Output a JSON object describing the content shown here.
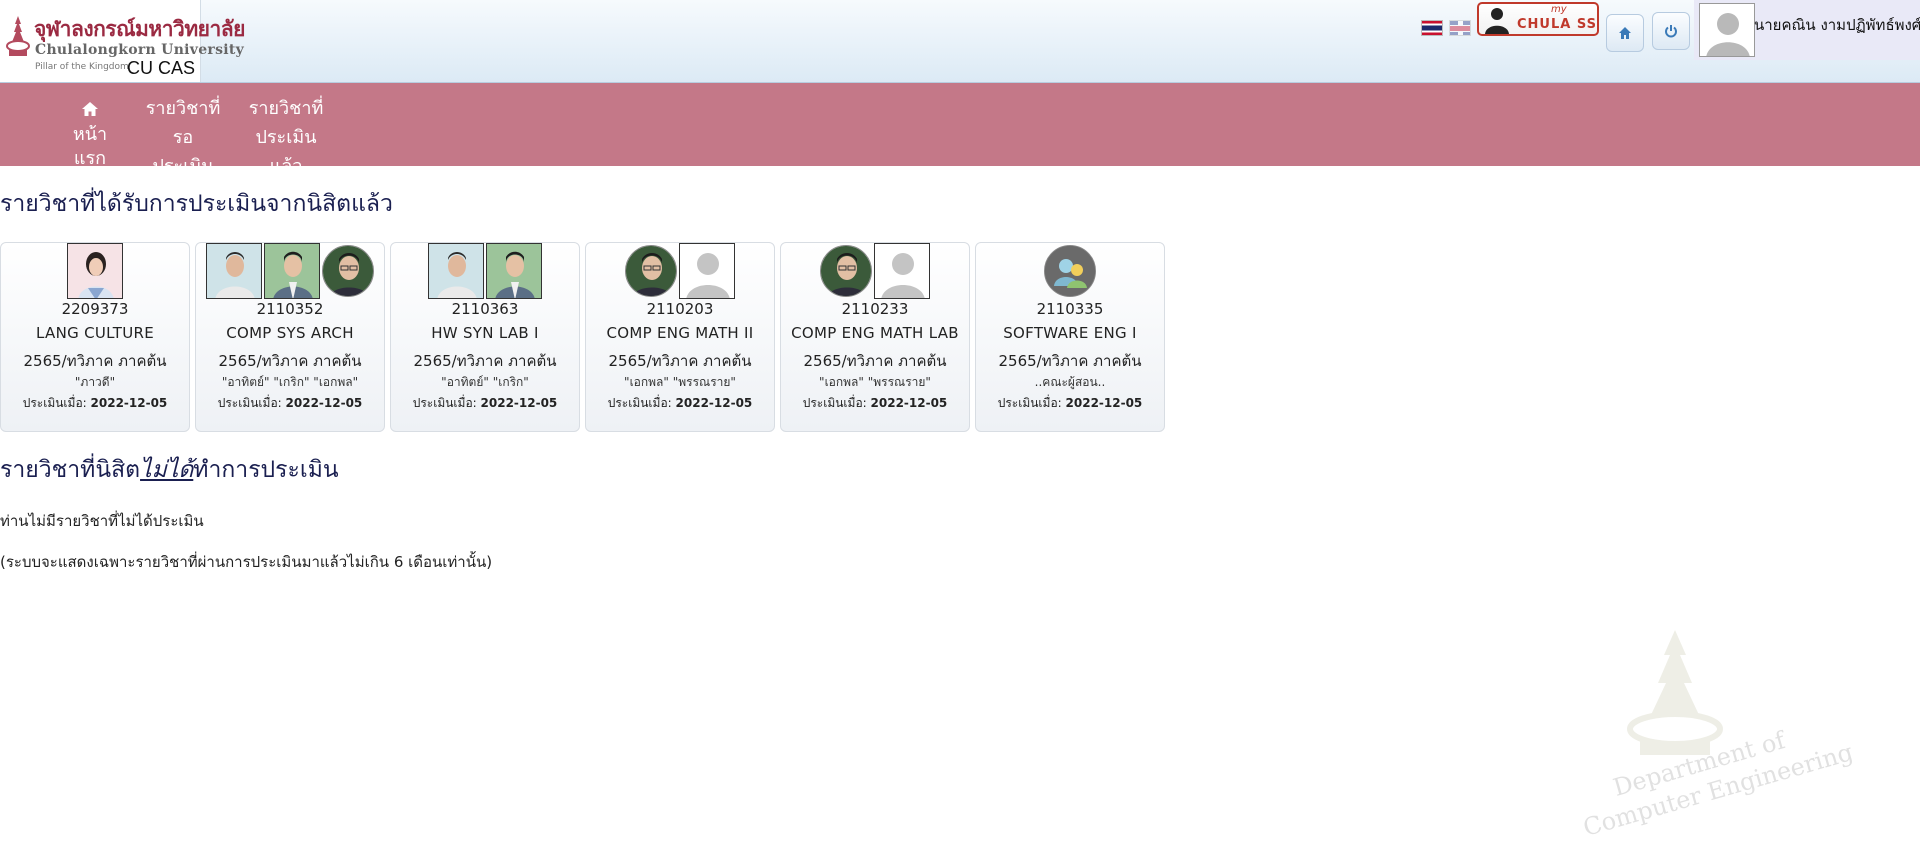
{
  "header": {
    "logo_th": "จุฬาลงกรณ์มหาวิทยาลัย",
    "logo_en": "Chulalongkorn University",
    "logo_tagline": "Pillar of the Kingdom",
    "app_name": "CU CAS",
    "sso_my": "my",
    "sso_label": "CHULA SSO",
    "user_name": "นายคณิน งามปฏิพัทธ์พงศ์"
  },
  "nav": {
    "home": "หน้าแรก",
    "pending_line1": "รายวิชาที่",
    "pending_line2": "รอประเมิน",
    "done_line1": "รายวิชาที่",
    "done_line2": "ประเมินแล้ว"
  },
  "section_evaluated": {
    "title": "รายวิชาที่ได้รับการประเมินจากนิสิตแล้ว",
    "eval_prefix": "ประเมินเมื่อ:",
    "courses": [
      {
        "code": "2209373",
        "name": "LANG CULTURE",
        "semester": "2565/ทวิภาค ภาคต้น",
        "instructors": "\"ภาวดี\"",
        "date": "2022-12-05"
      },
      {
        "code": "2110352",
        "name": "COMP SYS ARCH",
        "semester": "2565/ทวิภาค ภาคต้น",
        "instructors": "\"อาทิตย์\" \"เกริก\" \"เอกพล\"",
        "date": "2022-12-05"
      },
      {
        "code": "2110363",
        "name": "HW SYN LAB I",
        "semester": "2565/ทวิภาค ภาคต้น",
        "instructors": "\"อาทิตย์\" \"เกริก\"",
        "date": "2022-12-05"
      },
      {
        "code": "2110203",
        "name": "COMP ENG MATH II",
        "semester": "2565/ทวิภาค ภาคต้น",
        "instructors": "\"เอกพล\" \"พรรณราย\"",
        "date": "2022-12-05"
      },
      {
        "code": "2110233",
        "name": "COMP ENG MATH LAB",
        "semester": "2565/ทวิภาค ภาคต้น",
        "instructors": "\"เอกพล\" \"พรรณราย\"",
        "date": "2022-12-05"
      },
      {
        "code": "2110335",
        "name": "SOFTWARE ENG I",
        "semester": "2565/ทวิภาค ภาคต้น",
        "instructors": "..คณะผู้สอน..",
        "date": "2022-12-05"
      }
    ]
  },
  "section_not_evaluated": {
    "title_before": "รายวิชาที่นิสิต",
    "title_emph": "ไม่ได้",
    "title_after": "ทำการประเมิน",
    "empty_message": "ท่านไม่มีรายวิชาที่ไม่ได้ประเมิน",
    "note": "(ระบบจะแสดงเฉพาะรายวิชาที่ผ่านการประเมินมาแล้วไม่เกิน 6 เดือนเท่านั้น)"
  },
  "watermark": {
    "line1": "Department of",
    "line2": "Computer Engineering"
  },
  "colors": {
    "navbar": "#c47888",
    "title": "#1a1f50",
    "logo_red": "#9b2a42"
  }
}
